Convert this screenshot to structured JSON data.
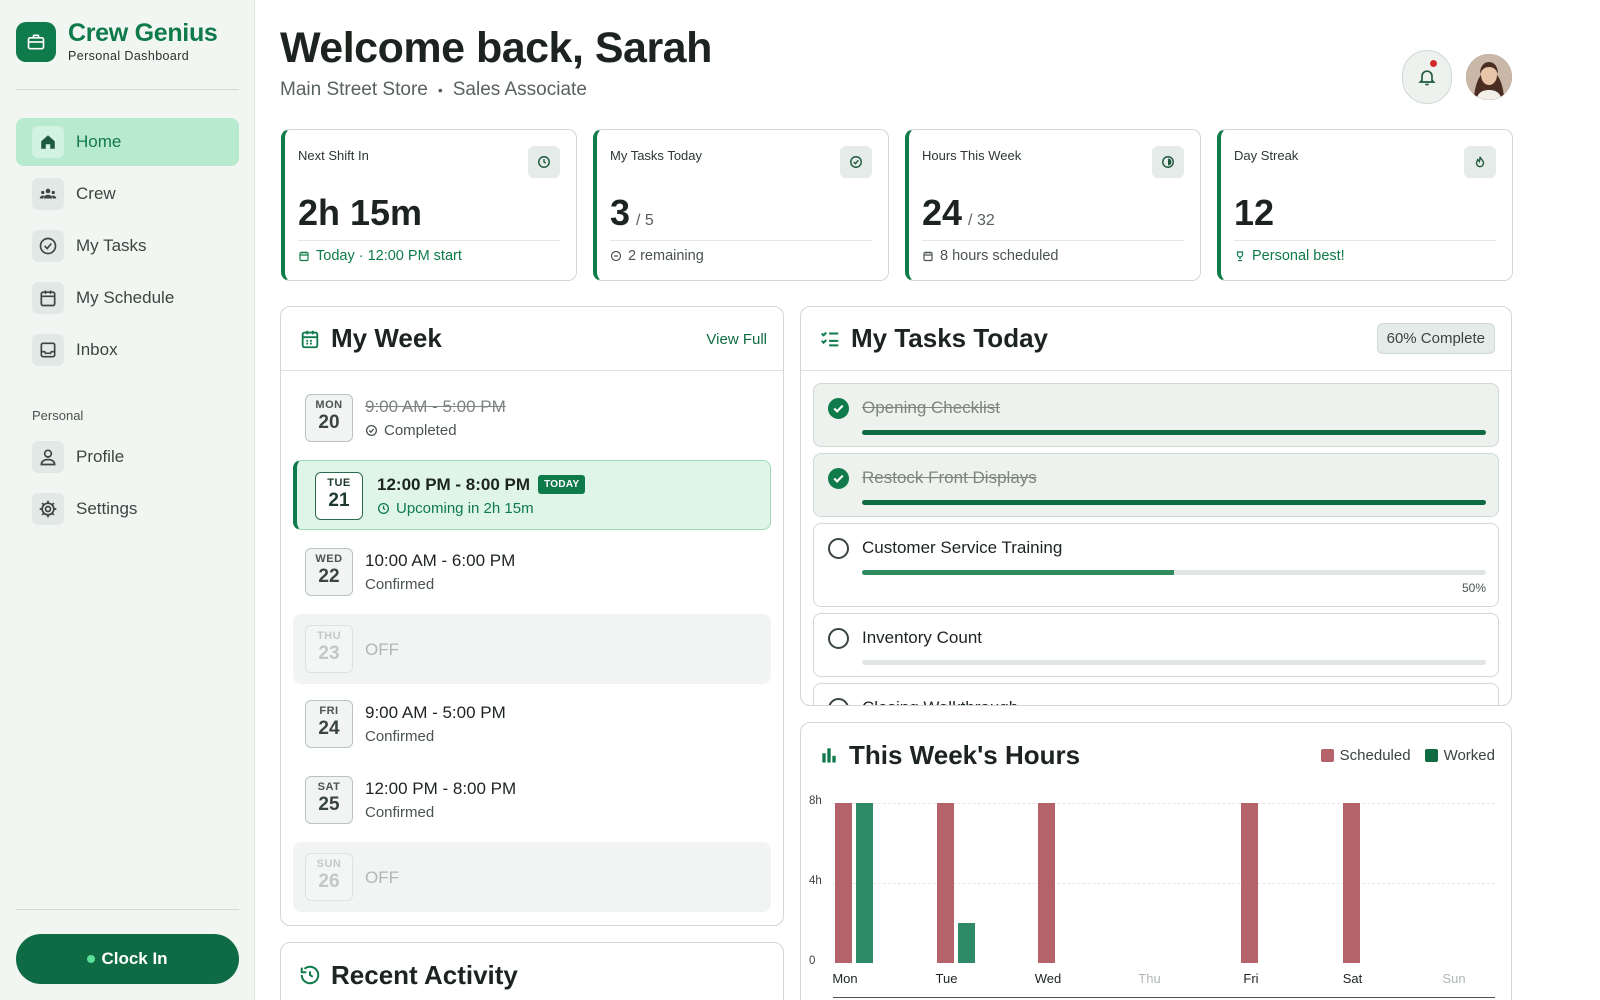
{
  "brand": {
    "name": "Crew Genius",
    "subtitle": "Personal Dashboard"
  },
  "nav": {
    "items": [
      {
        "label": "Home",
        "icon": "home-icon",
        "active": true
      },
      {
        "label": "Crew",
        "icon": "users-icon"
      },
      {
        "label": "My Tasks",
        "icon": "check-circle-icon"
      },
      {
        "label": "My Schedule",
        "icon": "calendar-icon"
      },
      {
        "label": "Inbox",
        "icon": "inbox-icon"
      }
    ],
    "section_label": "Personal",
    "personal_items": [
      {
        "label": "Profile",
        "icon": "user-icon"
      },
      {
        "label": "Settings",
        "icon": "gear-icon"
      }
    ],
    "clock_in_label": "Clock In"
  },
  "header": {
    "welcome": "Welcome back, Sarah",
    "store": "Main Street Store",
    "role": "Sales Associate"
  },
  "stats": [
    {
      "title": "Next Shift In",
      "value": "2h 15m",
      "suffix": "",
      "footer": "Today · 12:00 PM start",
      "icon": "clock-icon"
    },
    {
      "title": "My Tasks Today",
      "value": "3",
      "suffix": "/ 5",
      "footer": "2 remaining",
      "icon": "check-circle-icon"
    },
    {
      "title": "Hours This Week",
      "value": "24",
      "suffix": "/ 32",
      "footer": "8 hours scheduled",
      "icon": "pie-icon"
    },
    {
      "title": "Day Streak",
      "value": "12",
      "suffix": "",
      "footer": "Personal best!",
      "icon": "flame-icon"
    }
  ],
  "week": {
    "title": "My Week",
    "view_full": "View Full",
    "today_badge": "TODAY",
    "days": [
      {
        "dow": "MON",
        "date": "20",
        "time": "9:00 AM - 5:00 PM",
        "status": "Completed",
        "state": "done"
      },
      {
        "dow": "TUE",
        "date": "21",
        "time": "12:00 PM - 8:00 PM",
        "status": "Upcoming in 2h 15m",
        "state": "today"
      },
      {
        "dow": "WED",
        "date": "22",
        "time": "10:00 AM - 6:00 PM",
        "status": "Confirmed",
        "state": "confirmed"
      },
      {
        "dow": "THU",
        "date": "23",
        "time": "OFF",
        "status": "",
        "state": "off"
      },
      {
        "dow": "FRI",
        "date": "24",
        "time": "9:00 AM - 5:00 PM",
        "status": "Confirmed",
        "state": "confirmed"
      },
      {
        "dow": "SAT",
        "date": "25",
        "time": "12:00 PM - 8:00 PM",
        "status": "Confirmed",
        "state": "confirmed"
      },
      {
        "dow": "SUN",
        "date": "26",
        "time": "OFF",
        "status": "",
        "state": "off"
      }
    ]
  },
  "tasks": {
    "title": "My Tasks Today",
    "complete_badge": "60% Complete",
    "items": [
      {
        "name": "Opening Checklist",
        "done": true,
        "progress": 1.0,
        "pct_label": ""
      },
      {
        "name": "Restock Front Displays",
        "done": true,
        "progress": 1.0,
        "pct_label": ""
      },
      {
        "name": "Customer Service Training",
        "done": false,
        "progress": 0.5,
        "pct_label": "50%"
      },
      {
        "name": "Inventory Count",
        "done": false,
        "progress": 0.0,
        "pct_label": ""
      },
      {
        "name": "Closing Walkthrough",
        "done": false,
        "progress": 0.0,
        "pct_label": ""
      }
    ]
  },
  "hours_chart": {
    "title": "This Week's Hours",
    "colors": {
      "scheduled": "#b5636a",
      "worked": "#2f8a68"
    }
  },
  "chart_data": {
    "type": "bar",
    "categories": [
      "Mon",
      "Tue",
      "Wed",
      "Thu",
      "Fri",
      "Sat",
      "Sun"
    ],
    "series": [
      {
        "name": "Scheduled",
        "values": [
          8,
          8,
          8,
          0,
          8,
          8,
          0
        ]
      },
      {
        "name": "Worked",
        "values": [
          8,
          2,
          0,
          0,
          0,
          0,
          0
        ]
      }
    ],
    "yticks": [
      "0",
      "4h",
      "8h"
    ],
    "ylim": [
      0,
      8
    ],
    "grid": true,
    "legend": "top-right"
  },
  "activity": {
    "title": "Recent Activity"
  }
}
